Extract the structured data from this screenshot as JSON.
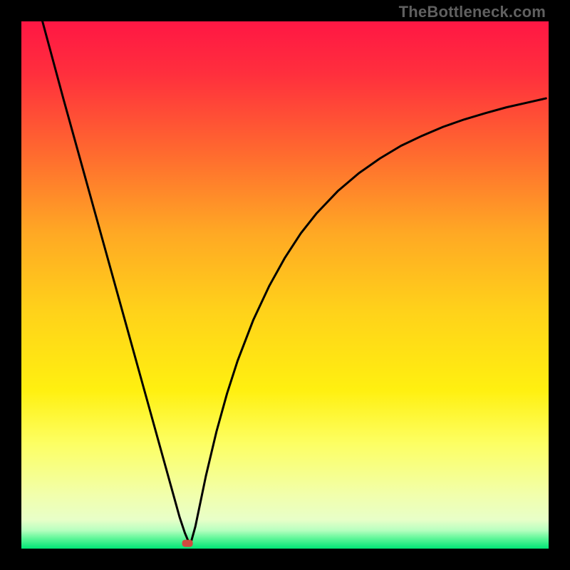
{
  "watermark": "TheBottleneck.com",
  "chart_data": {
    "type": "line",
    "title": "",
    "xlabel": "",
    "ylabel": "",
    "xlim": [
      0,
      1
    ],
    "ylim": [
      0,
      1
    ],
    "series": [
      {
        "name": "curve",
        "x": [
          0.04,
          0.06,
          0.08,
          0.1,
          0.12,
          0.14,
          0.16,
          0.18,
          0.2,
          0.22,
          0.24,
          0.26,
          0.28,
          0.29,
          0.3,
          0.31,
          0.315,
          0.32,
          0.33,
          0.34,
          0.35,
          0.37,
          0.39,
          0.41,
          0.44,
          0.47,
          0.5,
          0.53,
          0.56,
          0.6,
          0.64,
          0.68,
          0.72,
          0.76,
          0.8,
          0.84,
          0.88,
          0.92,
          0.96,
          0.995
        ],
        "y": [
          1.0,
          0.926,
          0.852,
          0.78,
          0.708,
          0.636,
          0.564,
          0.492,
          0.42,
          0.348,
          0.276,
          0.204,
          0.132,
          0.096,
          0.06,
          0.03,
          0.018,
          0.006,
          0.042,
          0.09,
          0.138,
          0.222,
          0.294,
          0.356,
          0.434,
          0.498,
          0.552,
          0.598,
          0.636,
          0.678,
          0.712,
          0.74,
          0.764,
          0.783,
          0.8,
          0.814,
          0.826,
          0.837,
          0.846,
          0.854
        ]
      }
    ],
    "marker": {
      "x": 0.315,
      "y": 0.01,
      "color": "#d24a3f"
    },
    "gradient_stops": [
      {
        "offset": 0.0,
        "color": "#ff1744"
      },
      {
        "offset": 0.1,
        "color": "#ff2f3d"
      },
      {
        "offset": 0.25,
        "color": "#ff6a2f"
      },
      {
        "offset": 0.4,
        "color": "#ffa824"
      },
      {
        "offset": 0.55,
        "color": "#ffd21a"
      },
      {
        "offset": 0.7,
        "color": "#fff010"
      },
      {
        "offset": 0.8,
        "color": "#fdff62"
      },
      {
        "offset": 0.9,
        "color": "#f1ffad"
      },
      {
        "offset": 0.945,
        "color": "#e8ffc8"
      },
      {
        "offset": 0.965,
        "color": "#b8ffc0"
      },
      {
        "offset": 0.98,
        "color": "#62f79a"
      },
      {
        "offset": 1.0,
        "color": "#00e676"
      }
    ]
  }
}
